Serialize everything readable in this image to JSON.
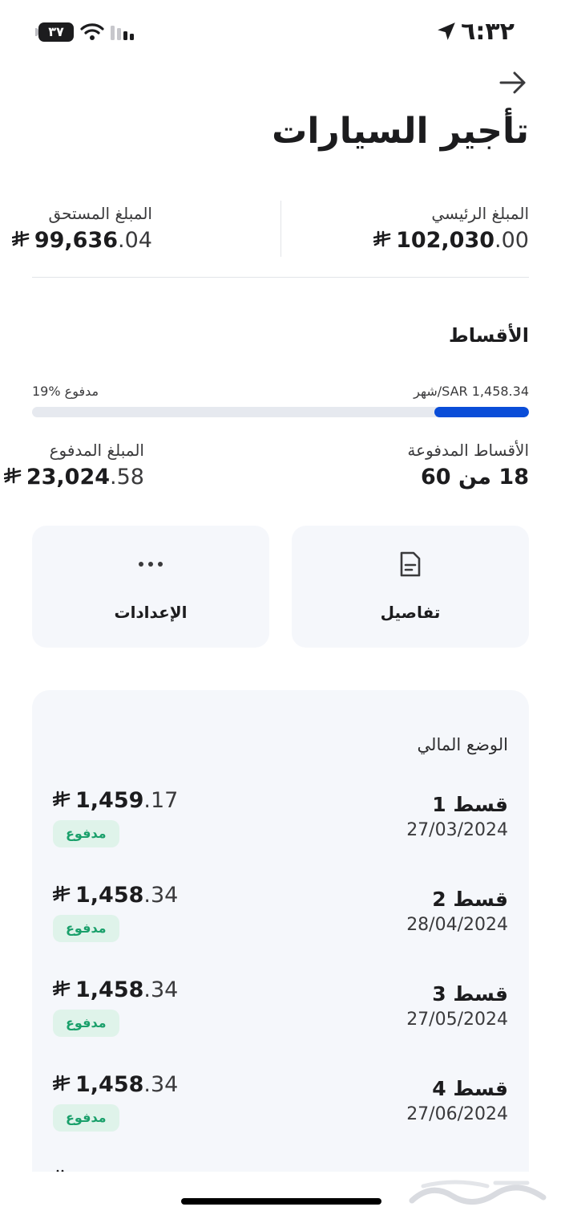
{
  "status_bar": {
    "time": "٦:٣٢",
    "battery": "٣٧"
  },
  "header": {
    "title": "تأجير السيارات"
  },
  "summary": {
    "principal": {
      "label": "المبلغ الرئيسي",
      "main": "102,030",
      "dec": ".00"
    },
    "due": {
      "label": "المبلغ المستحق",
      "main": "99,636",
      "dec": ".04"
    }
  },
  "installments": {
    "title": "الأقساط",
    "monthly": "شهر/SAR 1,458.34",
    "percent_paid": "19% مدفوع",
    "progress_fraction": 0.19,
    "paid_count": {
      "label": "الأقساط المدفوعة",
      "value": "18 من 60"
    },
    "paid_amount": {
      "label": "المبلغ المدفوع",
      "main": "23,024",
      "dec": ".58"
    }
  },
  "actions": {
    "details_label": "تفاصيل",
    "settings_label": "الإعدادات"
  },
  "financial_status": {
    "title": "الوضع المالي",
    "rows": [
      {
        "name": "قسط 1",
        "date": "27/03/2024",
        "main": "1,459",
        "dec": ".17",
        "status": "مدفوع"
      },
      {
        "name": "قسط 2",
        "date": "28/04/2024",
        "main": "1,458",
        "dec": ".34",
        "status": "مدفوع"
      },
      {
        "name": "قسط 3",
        "date": "27/05/2024",
        "main": "1,458",
        "dec": ".34",
        "status": "مدفوع"
      },
      {
        "name": "قسط 4",
        "date": "27/06/2024",
        "main": "1,458",
        "dec": ".34",
        "status": "مدفوع"
      }
    ]
  },
  "colors": {
    "accent": "#0a4dd8",
    "badge_bg": "#dff3ea",
    "badge_text": "#1aa06b"
  },
  "icons": {
    "back": "arrow-right-icon",
    "currency": "saudi-riyal-icon",
    "details": "document-icon",
    "settings": "more-dots-icon"
  }
}
